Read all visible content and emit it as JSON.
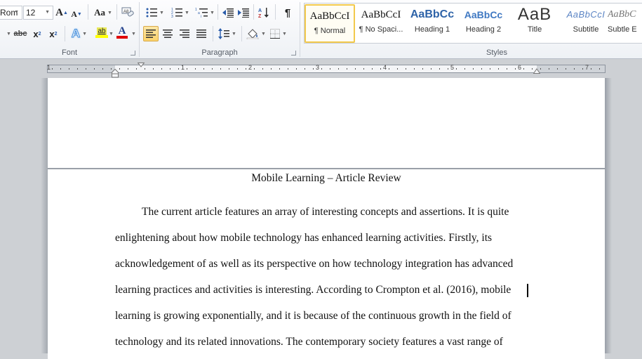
{
  "ribbon": {
    "font": {
      "label": "Font",
      "font_name": "Rom",
      "font_size": "12",
      "grow_font": "A",
      "shrink_font": "A",
      "change_case": "Aa",
      "clear_formatting": "A",
      "strikethrough": "abc",
      "subscript": "x",
      "superscript": "x",
      "text_effects": "A",
      "highlight": "ab",
      "font_color": "A",
      "highlight_color": "#ffff00",
      "font_color_value": "#e00000"
    },
    "paragraph": {
      "label": "Paragraph",
      "show_marks": "¶",
      "sort": "A↓"
    },
    "styles": {
      "label": "Styles",
      "items": [
        {
          "sample": "AaBbCcI",
          "name": "¶ Normal",
          "active": true
        },
        {
          "sample": "AaBbCcI",
          "name": "¶ No Spaci..."
        },
        {
          "sample": "AaBbCc",
          "name": "Heading 1"
        },
        {
          "sample": "AaBbCc",
          "name": "Heading 2"
        },
        {
          "sample": "AaB",
          "name": "Title"
        },
        {
          "sample": "AaBbCcI",
          "name": "Subtitle"
        },
        {
          "sample": "AaBbC",
          "name": "Subtle E"
        }
      ]
    }
  },
  "ruler": {
    "numbers": [
      "1",
      "1",
      "2",
      "3",
      "4",
      "5",
      "6",
      "7"
    ]
  },
  "document": {
    "title": "Mobile Learning – Article Review",
    "lines": [
      "The current article features an array of interesting concepts and assertions. It is quite",
      "enlightening about how mobile technology has enhanced learning activities. Firstly, its",
      "acknowledgement of as well as its perspective on how technology integration has advanced",
      "learning practices and activities is interesting. According to Crompton et al. (2016), mobile",
      "learning is growing exponentially, and it is because of the continuous growth in the field of",
      "technology and its related innovations. The contemporary society features a vast range of"
    ]
  }
}
